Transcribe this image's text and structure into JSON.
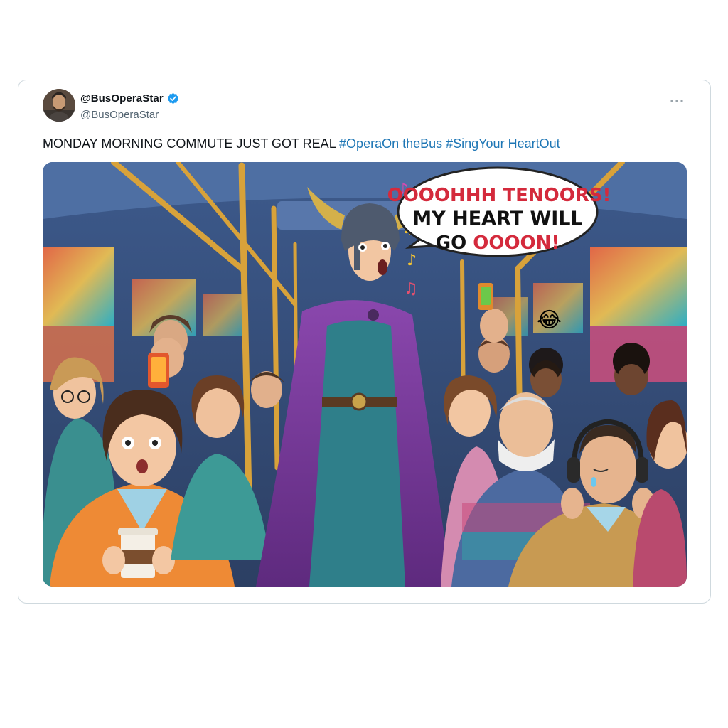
{
  "tweet": {
    "display_name": "@BusOperaStar",
    "handle": "@BusOperaStar",
    "verified_icon": "verified-badge-icon",
    "more_icon": "more-icon",
    "text_plain": "MONDAY MORNING COMMUTE JUST GOT REAL ",
    "hashtags": [
      "#OperaOn theBus",
      "#SingYour HeartOut"
    ],
    "colors": {
      "hashtag": "#1d76b5",
      "verified": "#1d9bf0",
      "border": "#cfd9de",
      "handle": "#536471"
    }
  },
  "image": {
    "speech_bubble": {
      "line1": "OOOOHHH TENOORS!",
      "line2": "MY HEART WILL",
      "line3_a": "GO ",
      "line3_b": "OOOON!"
    },
    "emoji": "😂",
    "colors": {
      "bubble_red": "#d42a3c",
      "cape": "#7b3b9b",
      "dress": "#2f7f8a",
      "bus": "#3e5a86"
    }
  }
}
